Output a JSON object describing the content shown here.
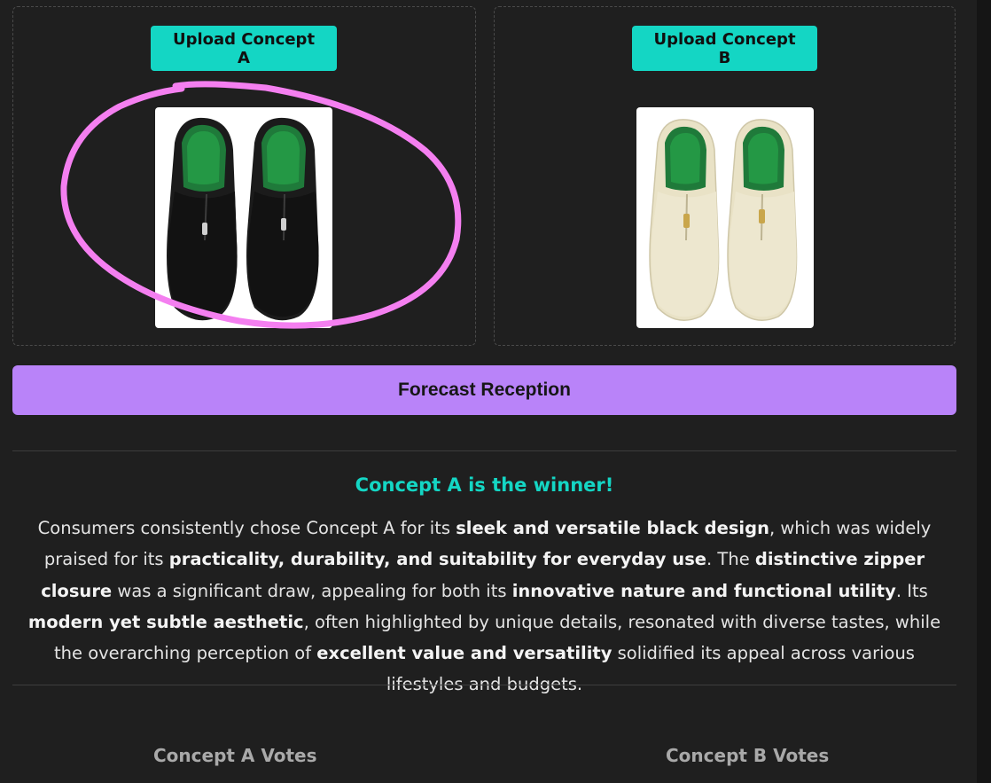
{
  "concept_a": {
    "upload_label": "Upload Concept A",
    "image_alt": "Black zip-front slip-on shoes with green insoles"
  },
  "concept_b": {
    "upload_label": "Upload Concept B",
    "image_alt": "Cream zip-front slip-on shoes with green insoles"
  },
  "forecast_button_label": "Forecast Reception",
  "result": {
    "winner_heading": "Concept A is the winner!",
    "summary_segments": [
      {
        "text": "Consumers consistently chose Concept A for its ",
        "bold": false
      },
      {
        "text": "sleek and versatile black design",
        "bold": true
      },
      {
        "text": ", which was widely praised for its ",
        "bold": false
      },
      {
        "text": "practicality, durability, and suitability for everyday use",
        "bold": true
      },
      {
        "text": ". The ",
        "bold": false
      },
      {
        "text": "distinctive zipper closure",
        "bold": true
      },
      {
        "text": " was a significant draw, appealing for both its ",
        "bold": false
      },
      {
        "text": "innovative nature and functional utility",
        "bold": true
      },
      {
        "text": ". Its ",
        "bold": false
      },
      {
        "text": "modern yet subtle aesthetic",
        "bold": true
      },
      {
        "text": ", often highlighted by unique details, resonated with diverse tastes, while the overarching perception of ",
        "bold": false
      },
      {
        "text": "excellent value and versatility",
        "bold": true
      },
      {
        "text": " solidified its appeal across various lifestyles and budgets.",
        "bold": false
      }
    ]
  },
  "votes": {
    "concept_a_label": "Concept A Votes",
    "concept_b_label": "Concept B Votes"
  },
  "colors": {
    "accent_teal": "#14d6c4",
    "forecast_purple": "#b983f9",
    "highlight_circle": "#f47ff0",
    "background": "#1f1f1f"
  }
}
